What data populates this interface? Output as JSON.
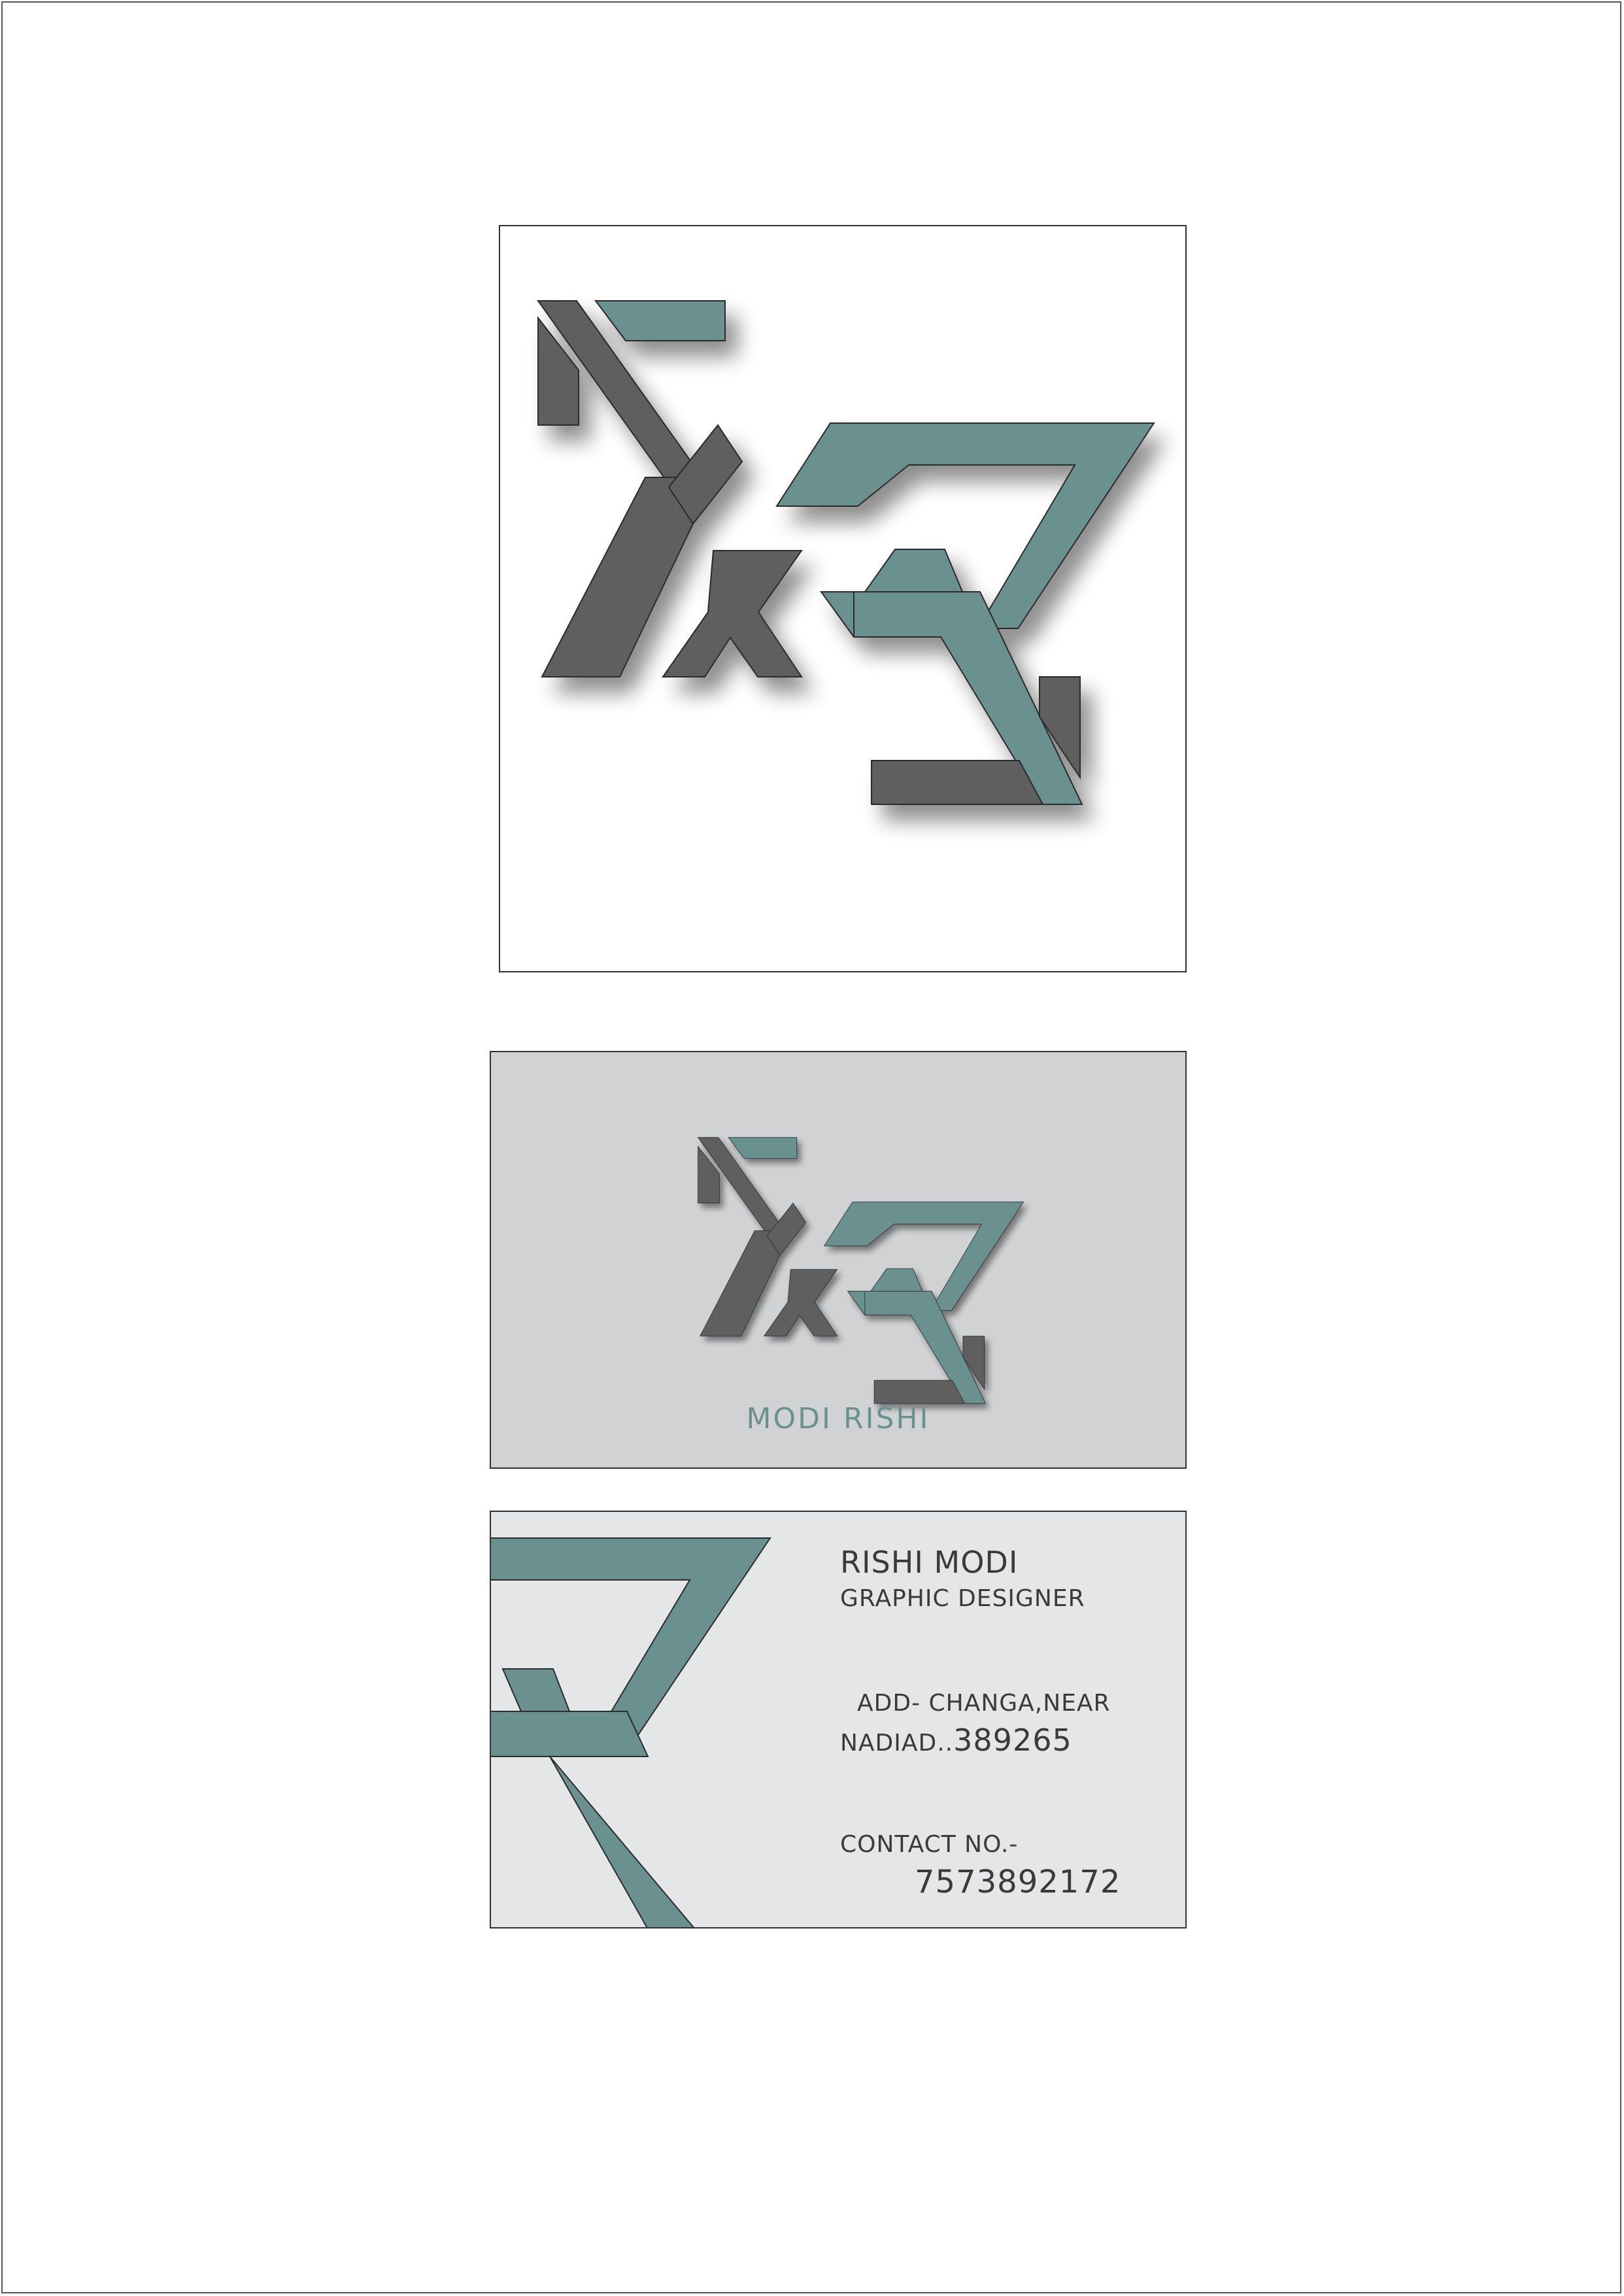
{
  "colors": {
    "teal": "#6a918f",
    "charcoal": "#5e5e60",
    "outline": "#2c2c2c",
    "page": "#ffffff",
    "front_card": "#d1d2d4",
    "back_card": "#e5e6e7",
    "text": "#3a3a3a"
  },
  "logo": {
    "icon": "rx-monogram-logo"
  },
  "front_card": {
    "brand_name": "MODI RISHI",
    "icon": "rx-monogram-logo"
  },
  "back_card": {
    "icon": "r-monogram-graphic",
    "name": "RISHI MODI",
    "title": "GRAPHIC DESIGNER",
    "address_line1": "ADD- CHANGA,NEAR",
    "address_line2_prefix": "NADIAD..",
    "address_pin": "389265",
    "contact_label": "CONTACT NO.-",
    "contact_number": "7573892172"
  }
}
